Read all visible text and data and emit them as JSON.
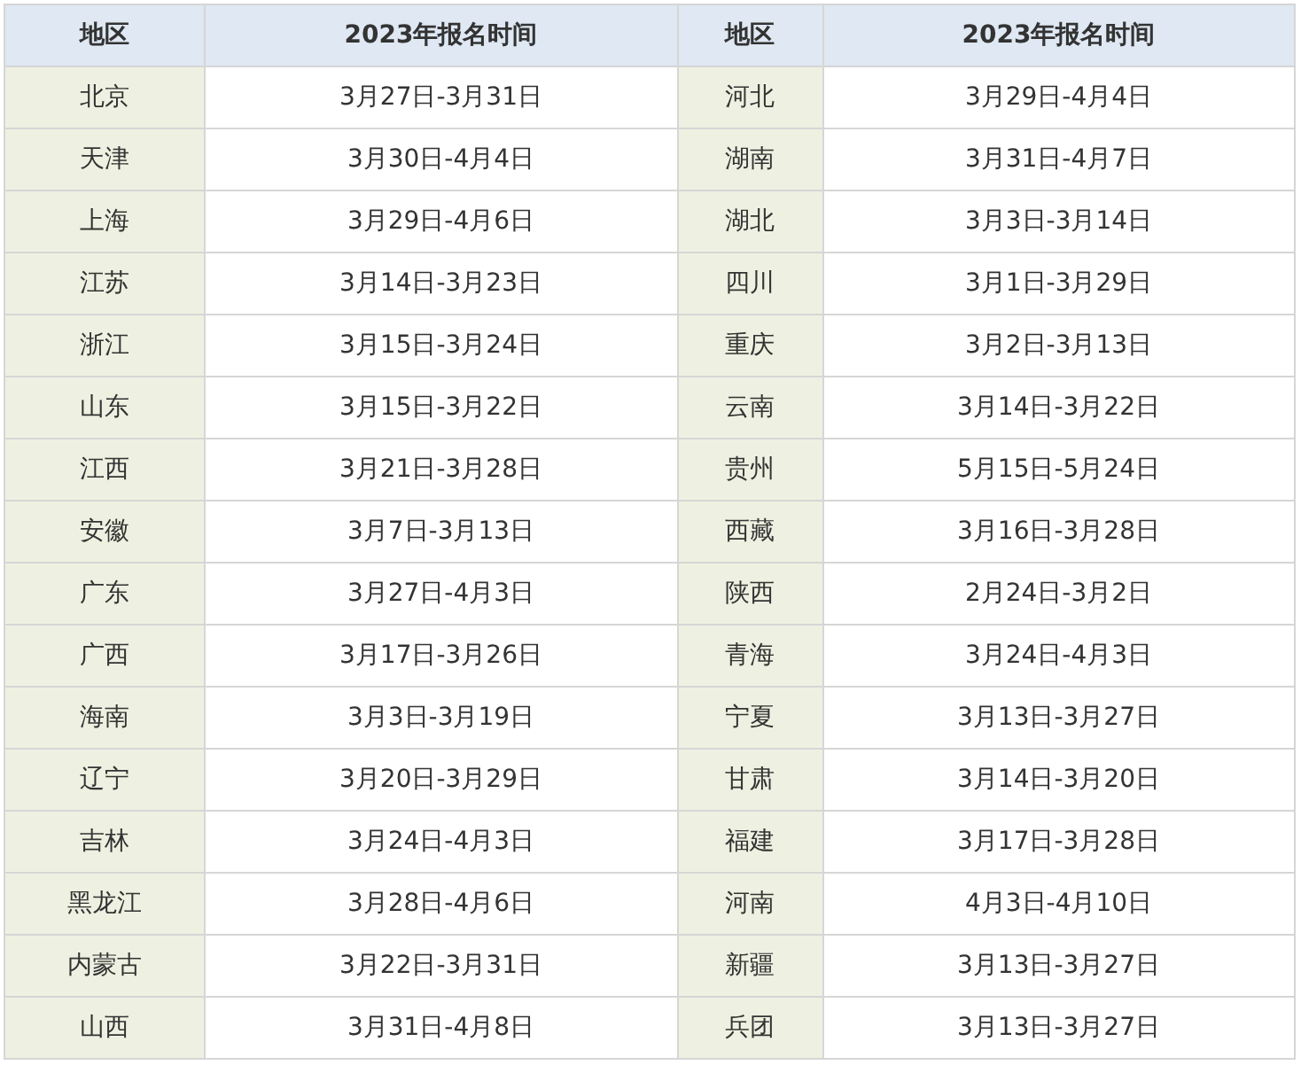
{
  "table": {
    "columns": [
      "地区",
      "2023年报名时间",
      "地区",
      "2023年报名时间"
    ],
    "rows": [
      [
        "北京",
        "3月27日-3月31日",
        "河北",
        "3月29日-4月4日"
      ],
      [
        "天津",
        "3月30日-4月4日",
        "湖南",
        "3月31日-4月7日"
      ],
      [
        "上海",
        "3月29日-4月6日",
        "湖北",
        "3月3日-3月14日"
      ],
      [
        "江苏",
        "3月14日-3月23日",
        "四川",
        "3月1日-3月29日"
      ],
      [
        "浙江",
        "3月15日-3月24日",
        "重庆",
        "3月2日-3月13日"
      ],
      [
        "山东",
        "3月15日-3月22日",
        "云南",
        "3月14日-3月22日"
      ],
      [
        "江西",
        "3月21日-3月28日",
        "贵州",
        "5月15日-5月24日"
      ],
      [
        "安徽",
        "3月7日-3月13日",
        "西藏",
        "3月16日-3月28日"
      ],
      [
        "广东",
        "3月27日-4月3日",
        "陕西",
        "2月24日-3月2日"
      ],
      [
        "广西",
        "3月17日-3月26日",
        "青海",
        "3月24日-4月3日"
      ],
      [
        "海南",
        "3月3日-3月19日",
        "宁夏",
        "3月13日-3月27日"
      ],
      [
        "辽宁",
        "3月20日-3月29日",
        "甘肃",
        "3月14日-3月20日"
      ],
      [
        "吉林",
        "3月24日-4月3日",
        "福建",
        "3月17日-3月28日"
      ],
      [
        "黑龙江",
        "3月28日-4月6日",
        "河南",
        "4月3日-4月10日"
      ],
      [
        "内蒙古",
        "3月22日-3月31日",
        "新疆",
        "3月13日-3月27日"
      ],
      [
        "山西",
        "3月31日-4月8日",
        "兵团",
        "3月13日-3月27日"
      ]
    ]
  }
}
